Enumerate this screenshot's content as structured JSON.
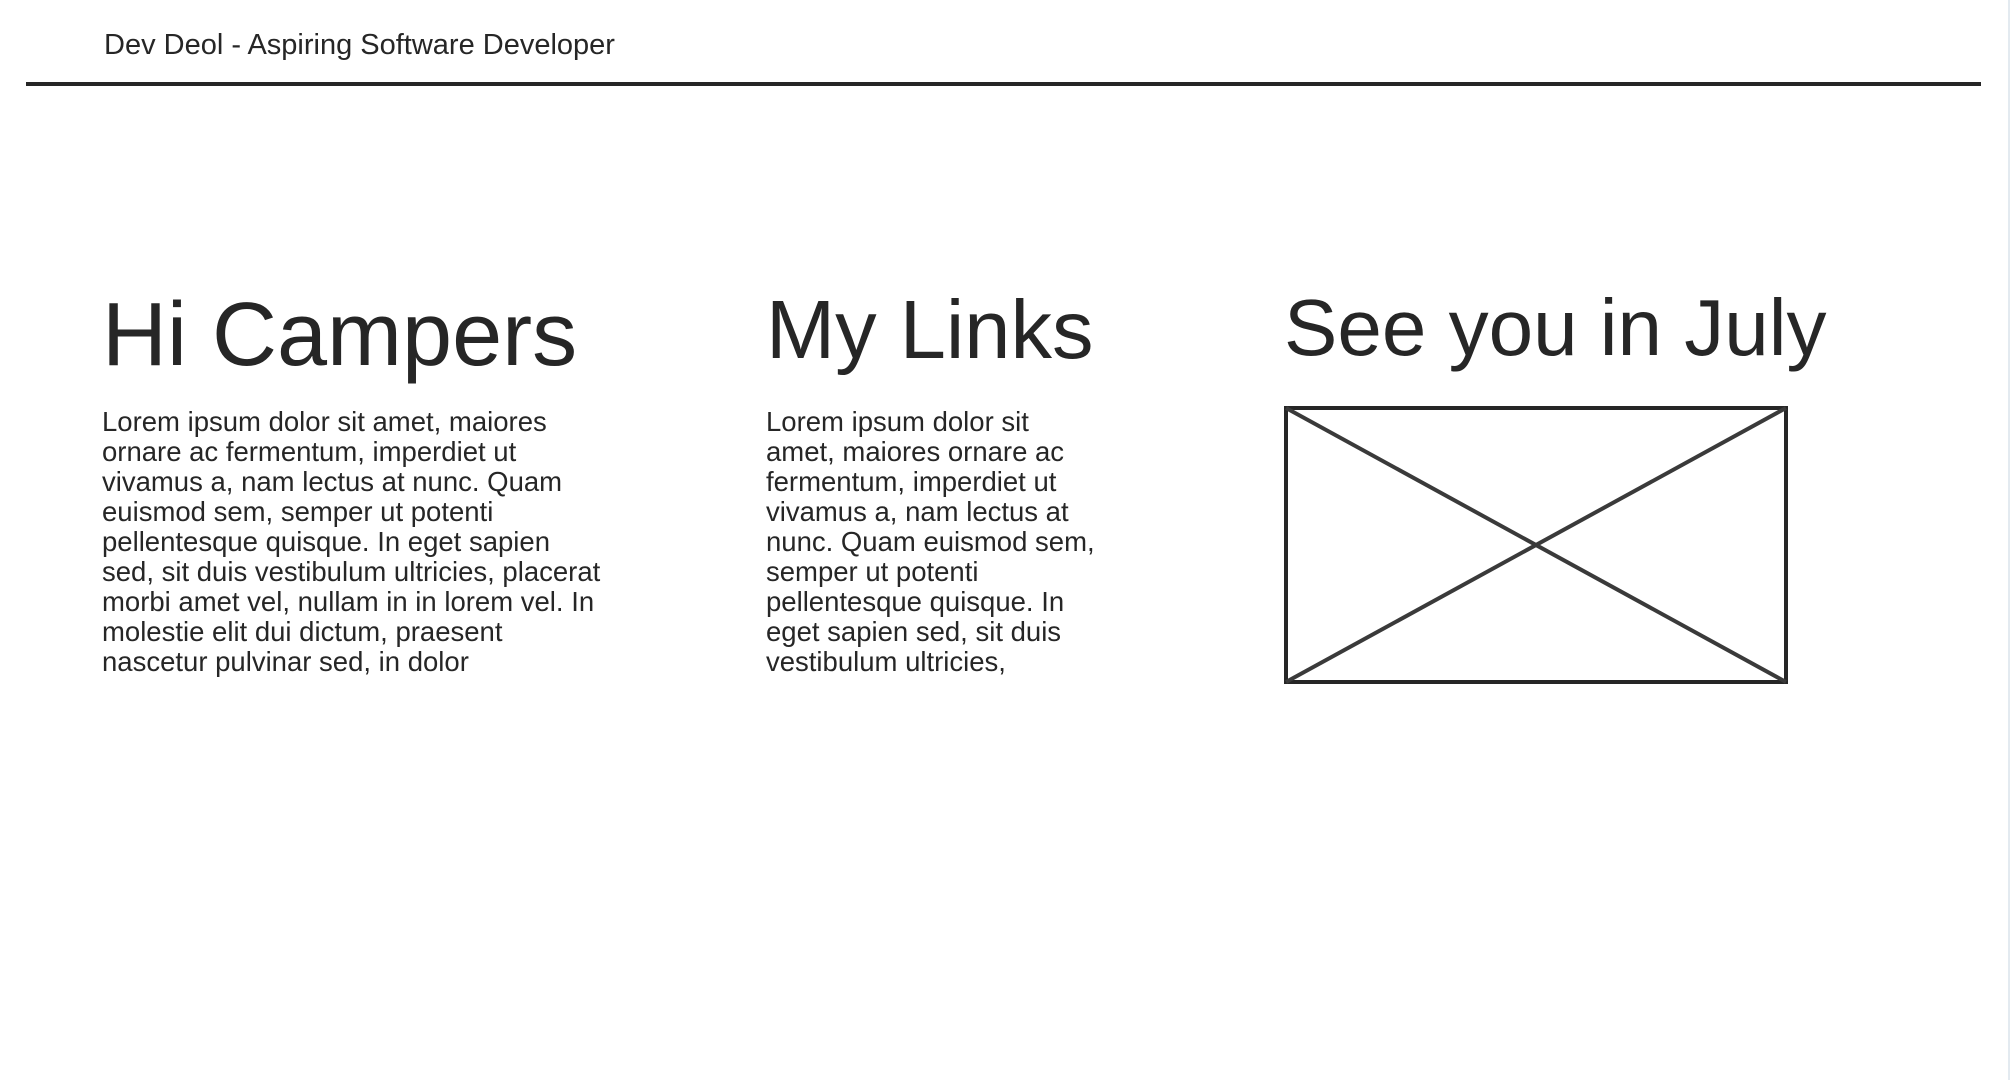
{
  "header": {
    "site_title": "Dev Deol - Aspiring Software Developer"
  },
  "columns": [
    {
      "heading": "Hi Campers",
      "body": "Lorem ipsum dolor sit amet, maiores ornare ac fermentum, imperdiet ut vivamus a, nam lectus at nunc. Quam euismod sem, semper ut potenti pellentesque quisque. In eget sapien sed, sit duis vestibulum ultricies, placerat morbi amet vel, nullam in in lorem vel. In molestie elit dui dictum, praesent nascetur pulvinar sed, in dolor"
    },
    {
      "heading": "My Links",
      "body": "Lorem ipsum dolor sit amet, maiores ornare ac fermentum, imperdiet ut vivamus a, nam lectus at nunc. Quam euismod sem, semper ut potenti pellentesque quisque. In eget sapien sed, sit duis vestibulum ultricies,"
    },
    {
      "heading": "See you in July",
      "image_icon": "image-placeholder-icon"
    }
  ],
  "colors": {
    "text": "#262626",
    "rule": "#262626",
    "background": "#ffffff",
    "edge": "#e3eaf0"
  }
}
